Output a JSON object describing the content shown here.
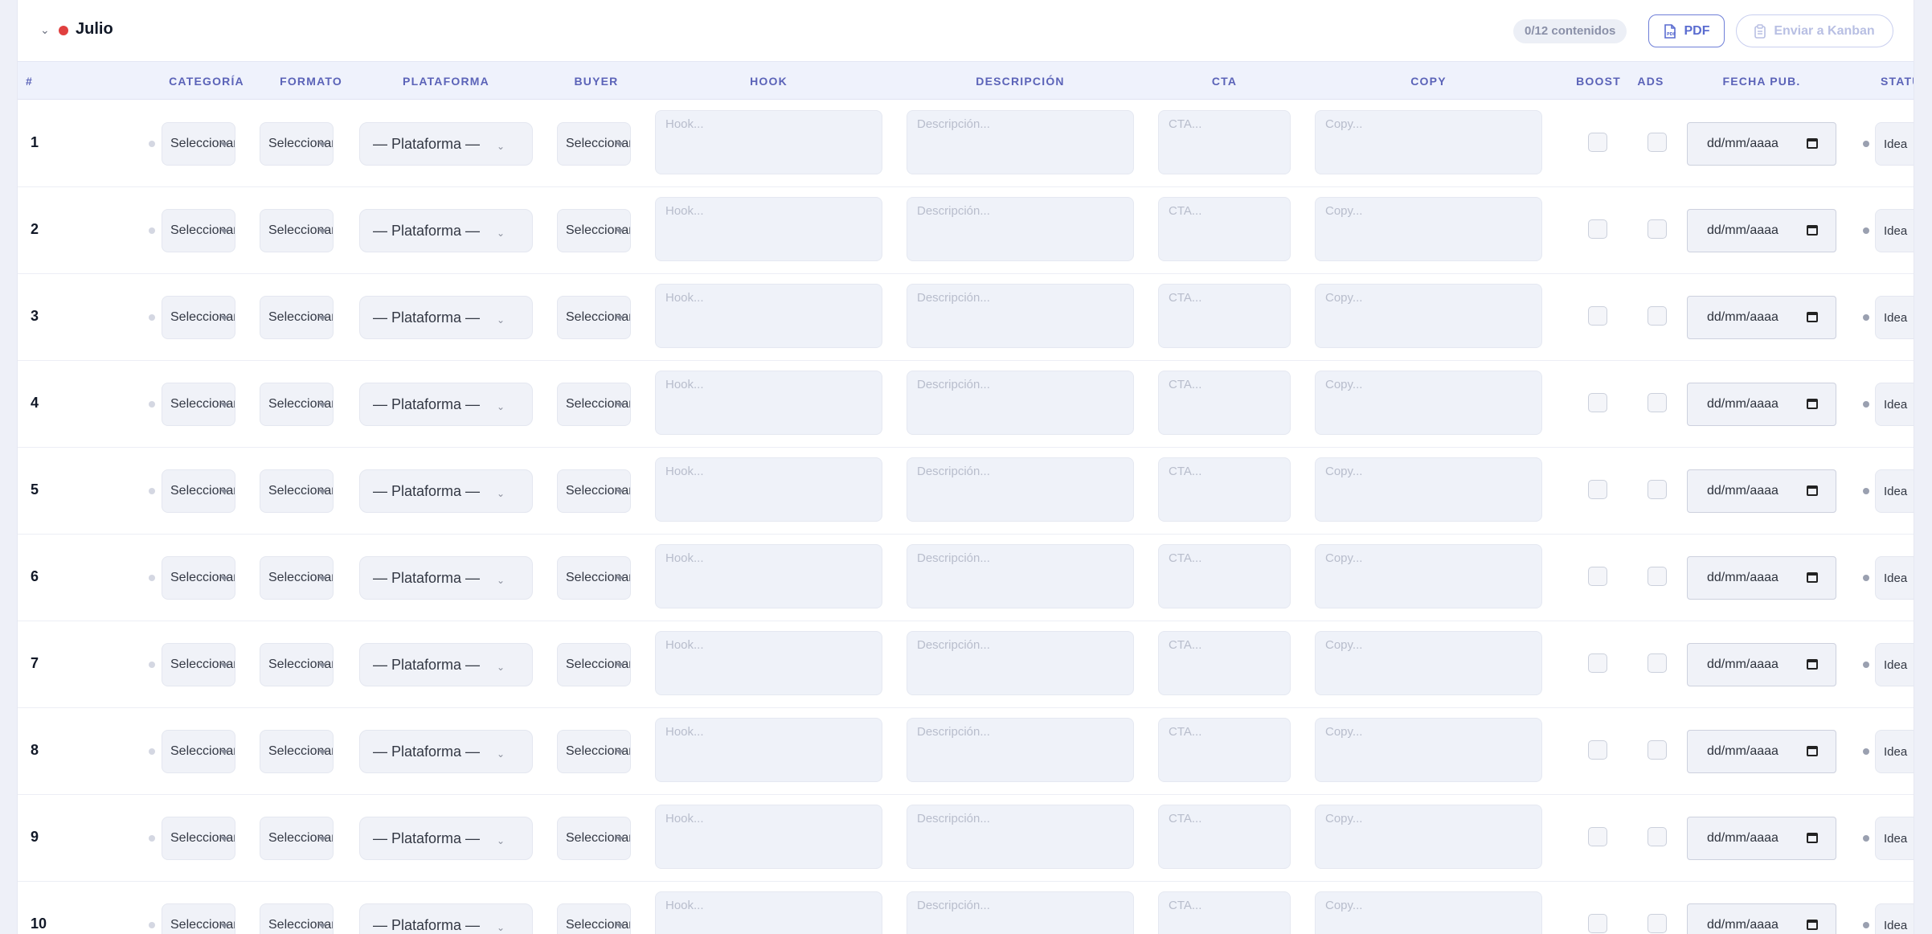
{
  "section": {
    "month": "Julio",
    "month_color": "#e0403f",
    "count_label": "0/12 contenidos"
  },
  "actions": {
    "pdf_label": "PDF",
    "kanban_label": "Enviar a Kanban"
  },
  "columns": {
    "num": "#",
    "categoria": "CATEGORÍA",
    "formato": "FORMATO",
    "plataforma": "PLATAFORMA",
    "buyer": "BUYER",
    "hook": "HOOK",
    "descripcion": "DESCRIPCIÓN",
    "cta": "CTA",
    "copy": "COPY",
    "boost": "BOOST",
    "ads": "ADS",
    "fecha": "FECHA PUB.",
    "status": "STATUS"
  },
  "placeholders": {
    "select": "Seleccionar",
    "plataforma": "— Plataforma —",
    "hook": "Hook...",
    "descripcion": "Descripción...",
    "cta": "CTA...",
    "copy": "Copy...",
    "date": "dd/mm/aaaa"
  },
  "rows": [
    {
      "num": "1",
      "status": "Idea"
    },
    {
      "num": "2",
      "status": "Idea"
    },
    {
      "num": "3",
      "status": "Idea"
    },
    {
      "num": "4",
      "status": "Idea"
    },
    {
      "num": "5",
      "status": "Idea"
    },
    {
      "num": "6",
      "status": "Idea"
    },
    {
      "num": "7",
      "status": "Idea"
    },
    {
      "num": "8",
      "status": "Idea"
    },
    {
      "num": "9",
      "status": "Idea"
    },
    {
      "num": "10",
      "status": "Idea"
    }
  ]
}
